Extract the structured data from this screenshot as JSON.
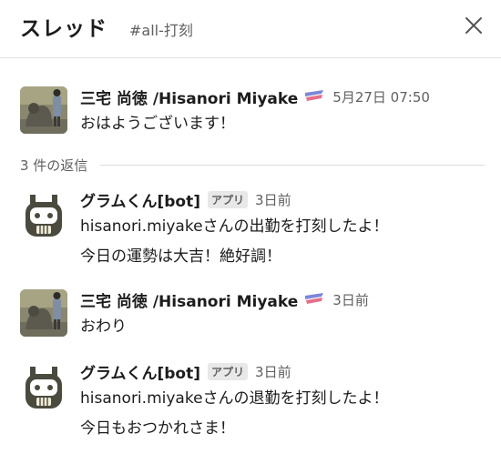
{
  "header": {
    "title": "スレッド",
    "channel": "#all-打刻",
    "close_icon": "close-icon"
  },
  "replies_label": "3 件の返信",
  "messages": [
    {
      "author": "三宅 尚徳 /Hisanori Miyake",
      "timestamp": "5月27日 07:50",
      "lines": [
        "おはようございます！"
      ],
      "avatar_icon": "user-photo-avatar",
      "status_icon": "status-emoji-icon"
    },
    {
      "author": "グラムくん[bot]",
      "badge": "アプリ",
      "timestamp": "3日前",
      "lines": [
        "hisanori.miyakeさんの出勤を打刻したよ！",
        "今日の運勢は大吉！絶好調！"
      ],
      "avatar_icon": "robot-avatar"
    },
    {
      "author": "三宅 尚徳 /Hisanori Miyake",
      "timestamp": "3日前",
      "lines": [
        "おわり"
      ],
      "avatar_icon": "user-photo-avatar",
      "status_icon": "status-emoji-icon"
    },
    {
      "author": "グラムくん[bot]",
      "badge": "アプリ",
      "timestamp": "3日前",
      "lines": [
        "hisanori.miyakeさんの退勤を打刻したよ！",
        "今日もおつかれさま！"
      ],
      "avatar_icon": "robot-avatar"
    }
  ]
}
